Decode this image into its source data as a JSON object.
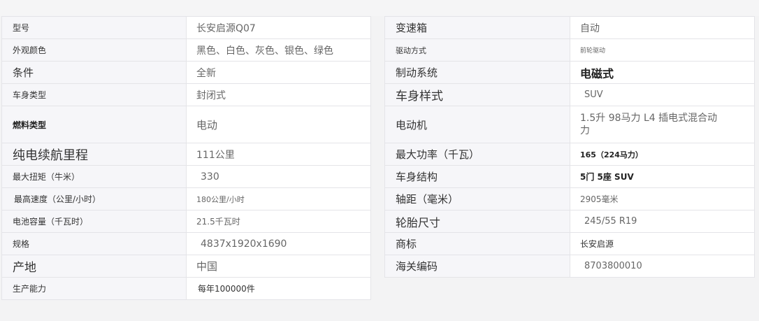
{
  "spec_left": [
    {
      "label": "型号",
      "value": "长安启源Q07"
    },
    {
      "label": "外观颜色",
      "value": "黑色、白色、灰色、银色、绿色"
    },
    {
      "label": "条件",
      "value": "全新"
    },
    {
      "label": "车身类型",
      "value": "封闭式"
    },
    {
      "label": "燃料类型",
      "value": "电动"
    },
    {
      "label": "纯电续航里程",
      "value": "111公里"
    },
    {
      "label": "最大扭矩（牛米）",
      "value": "330"
    },
    {
      "label": "最高速度（公里/小时）",
      "value": "180公里/小时"
    },
    {
      "label": "电池容量（千瓦时）",
      "value": "21.5千瓦时"
    },
    {
      "label": "规格",
      "value": "4837x1920x1690"
    },
    {
      "label": "产地",
      "value": "中国"
    },
    {
      "label": "生产能力",
      "value": "每年100000件"
    }
  ],
  "spec_right": [
    {
      "label": "变速箱",
      "value": "自动"
    },
    {
      "label": "驱动方式",
      "value": "前轮驱动"
    },
    {
      "label": "制动系统",
      "value": "电磁式"
    },
    {
      "label": "车身样式",
      "value": "SUV"
    },
    {
      "label": "电动机",
      "value": "1.5升 98马力 L4 插电式混合动力"
    },
    {
      "label": "最大功率（千瓦）",
      "value": "165（224马力）"
    },
    {
      "label": "车身结构",
      "value": "5门 5座 SUV"
    },
    {
      "label": "轴距（毫米）",
      "value": "2905毫米"
    },
    {
      "label": "轮胎尺寸",
      "value": "245/55 R19"
    },
    {
      "label": "商标",
      "value": "长安启源"
    },
    {
      "label": "海关编码",
      "value": "8703800010"
    }
  ]
}
